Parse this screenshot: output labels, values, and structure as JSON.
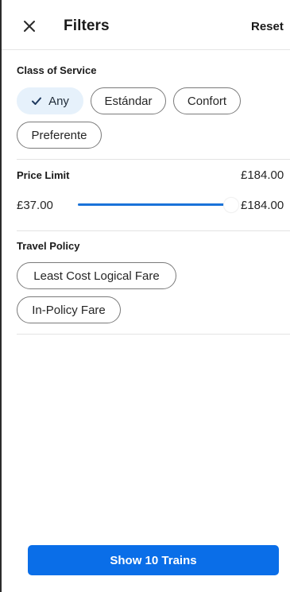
{
  "header": {
    "title": "Filters",
    "reset_label": "Reset",
    "close_icon": "close-icon"
  },
  "class_of_service": {
    "title": "Class of Service",
    "options": [
      {
        "label": "Any",
        "selected": true
      },
      {
        "label": "Estándar",
        "selected": false
      },
      {
        "label": "Confort",
        "selected": false
      },
      {
        "label": "Preferente",
        "selected": false
      }
    ]
  },
  "price_limit": {
    "title": "Price Limit",
    "current_value": "£184.00",
    "min_label": "£37.00",
    "max_label": "£184.00",
    "fill_fraction": 1.0
  },
  "travel_policy": {
    "title": "Travel Policy",
    "options": [
      {
        "label": "Least Cost Logical Fare",
        "selected": false
      },
      {
        "label": "In-Policy Fare",
        "selected": false
      }
    ]
  },
  "footer": {
    "show_button_label": "Show 10 Trains"
  },
  "colors": {
    "accent": "#0a6ee8",
    "slider_fill": "#1a73d9",
    "selected_chip_bg": "#e6f1fb"
  }
}
